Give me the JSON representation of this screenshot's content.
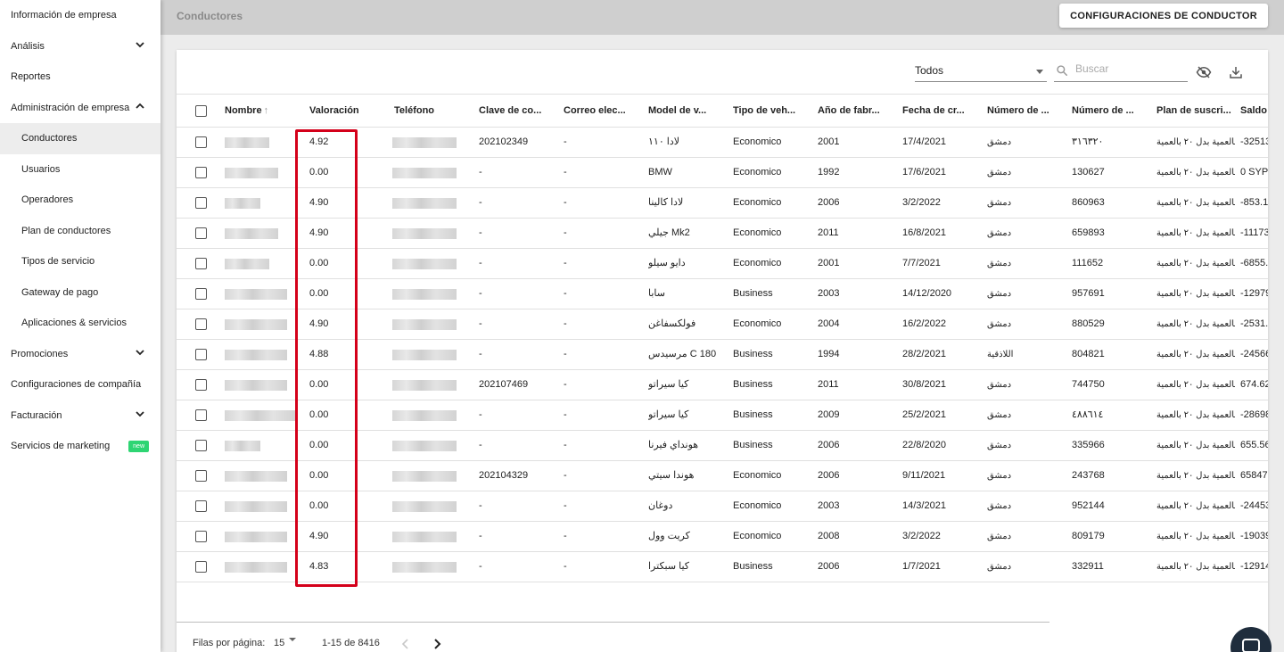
{
  "sidebar": {
    "items": [
      {
        "label": "Información de empresa",
        "level": 0,
        "chevron": "none"
      },
      {
        "label": "Análisis",
        "level": 0,
        "chevron": "down"
      },
      {
        "label": "Reportes",
        "level": 0,
        "chevron": "none"
      },
      {
        "label": "Administración de empresa",
        "level": 0,
        "chevron": "up"
      },
      {
        "label": "Conductores",
        "level": 1,
        "chevron": "none",
        "active": true
      },
      {
        "label": "Usuarios",
        "level": 1,
        "chevron": "none"
      },
      {
        "label": "Operadores",
        "level": 1,
        "chevron": "none"
      },
      {
        "label": "Plan de conductores",
        "level": 1,
        "chevron": "none"
      },
      {
        "label": "Tipos de servicio",
        "level": 1,
        "chevron": "none"
      },
      {
        "label": "Gateway de pago",
        "level": 1,
        "chevron": "none"
      },
      {
        "label": "Aplicaciones & servicios",
        "level": 1,
        "chevron": "none"
      },
      {
        "label": "Promociones",
        "level": 0,
        "chevron": "down"
      },
      {
        "label": "Configuraciones de compañía",
        "level": 0,
        "chevron": "none"
      },
      {
        "label": "Facturación",
        "level": 0,
        "chevron": "down"
      },
      {
        "label": "Servicios de marketing",
        "level": 0,
        "chevron": "none",
        "badge": "new"
      }
    ]
  },
  "header": {
    "title": "Conductores",
    "config_button": "CONFIGURACIONES DE CONDUCTOR"
  },
  "toolbar": {
    "filter_value": "Todos",
    "search_placeholder": "Buscar",
    "icons": [
      "visibility-off-icon",
      "download-icon"
    ]
  },
  "table": {
    "columns": [
      "Nombre",
      "Valoración",
      "Teléfono",
      "Clave de co...",
      "Correo elec...",
      "Model de v...",
      "Tipo de veh...",
      "Año de fabr...",
      "Fecha de cr...",
      "Número de ...",
      "Número de ...",
      "Plan de suscri...",
      "Saldo"
    ],
    "sort_column": "Nombre",
    "sort_direction": "asc",
    "rows": [
      {
        "rating": "4.92",
        "key": "202102349",
        "email": "-",
        "model": "لادا ١١٠",
        "type": "Economico",
        "year": "2001",
        "date": "17/4/2021",
        "city": "دمشق",
        "number": "٣١٦٣٢٠",
        "plan": "بالعمية بدل ٢٠ بالعمية",
        "balance": "-32513"
      },
      {
        "rating": "0.00",
        "key": "-",
        "email": "-",
        "model": "BMW",
        "type": "Economico",
        "year": "1992",
        "date": "17/6/2021",
        "city": "دمشق",
        "number": "130627",
        "plan": "بالعمية بدل ٢٠ بالعمية",
        "balance": "0 SYP"
      },
      {
        "rating": "4.90",
        "key": "-",
        "email": "-",
        "model": "لادا كالينا",
        "type": "Economico",
        "year": "2006",
        "date": "3/2/2022",
        "city": "دمشق",
        "number": "860963",
        "plan": "بالعمية بدل ٢٠ بالعمية",
        "balance": "-853.1"
      },
      {
        "rating": "4.90",
        "key": "-",
        "email": "-",
        "model": "جيلي Mk2",
        "type": "Economico",
        "year": "2011",
        "date": "16/8/2021",
        "city": "دمشق",
        "number": "659893",
        "plan": "بالعمية بدل ٢٠ بالعمية",
        "balance": "-11173"
      },
      {
        "rating": "0.00",
        "key": "-",
        "email": "-",
        "model": "دايو سيلو",
        "type": "Economico",
        "year": "2001",
        "date": "7/7/2021",
        "city": "دمشق",
        "number": "111652",
        "plan": "بالعمية بدل ٢٠ بالعمية",
        "balance": "-6855."
      },
      {
        "rating": "0.00",
        "key": "-",
        "email": "-",
        "model": "سابا",
        "type": "Business",
        "year": "2003",
        "date": "14/12/2020",
        "city": "دمشق",
        "number": "957691",
        "plan": "بالعمية بدل ٢٠ بالعمية",
        "balance": "-12979"
      },
      {
        "rating": "4.90",
        "key": "-",
        "email": "-",
        "model": "فولكسفاغن",
        "type": "Economico",
        "year": "2004",
        "date": "16/2/2022",
        "city": "دمشق",
        "number": "880529",
        "plan": "بالعمية بدل ٢٠ بالعمية",
        "balance": "-2531."
      },
      {
        "rating": "4.88",
        "key": "-",
        "email": "-",
        "model": "مرسيدس C 180",
        "type": "Business",
        "year": "1994",
        "date": "28/2/2021",
        "city": "اللاذقية",
        "number": "804821",
        "plan": "بالعمية بدل ٢٠ بالعمية",
        "balance": "-24566"
      },
      {
        "rating": "0.00",
        "key": "202107469",
        "email": "-",
        "model": "كيا سيراتو",
        "type": "Business",
        "year": "2011",
        "date": "30/8/2021",
        "city": "دمشق",
        "number": "744750",
        "plan": "بالعمية بدل ٢٠ بالعمية",
        "balance": "674.62"
      },
      {
        "rating": "0.00",
        "key": "-",
        "email": "-",
        "model": "كيا سيراتو",
        "type": "Business",
        "year": "2009",
        "date": "25/2/2021",
        "city": "دمشق",
        "number": "٤٨٨٦١٤",
        "plan": "بالعمية بدل ٢٠ بالعمية",
        "balance": "-28698"
      },
      {
        "rating": "0.00",
        "key": "-",
        "email": "-",
        "model": "هونداي فيرنا",
        "type": "Business",
        "year": "2006",
        "date": "22/8/2020",
        "city": "دمشق",
        "number": "335966",
        "plan": "بالعمية بدل ٢٠ بالعمية",
        "balance": "655.56"
      },
      {
        "rating": "0.00",
        "key": "202104329",
        "email": "-",
        "model": "هوندا سيتي",
        "type": "Economico",
        "year": "2006",
        "date": "9/11/2021",
        "city": "دمشق",
        "number": "243768",
        "plan": "بالعمية بدل ٢٠ بالعمية",
        "balance": "65847"
      },
      {
        "rating": "0.00",
        "key": "-",
        "email": "-",
        "model": "دوغان",
        "type": "Economico",
        "year": "2003",
        "date": "14/3/2021",
        "city": "دمشق",
        "number": "952144",
        "plan": "بالعمية بدل ٢٠ بالعمية",
        "balance": "-24453"
      },
      {
        "rating": "4.90",
        "key": "-",
        "email": "-",
        "model": "كريت وول",
        "type": "Economico",
        "year": "2008",
        "date": "3/2/2022",
        "city": "دمشق",
        "number": "809179",
        "plan": "بالعمية بدل ٢٠ بالعمية",
        "balance": "-19039"
      },
      {
        "rating": "4.83",
        "key": "-",
        "email": "-",
        "model": "كيا سبكترا",
        "type": "Business",
        "year": "2006",
        "date": "1/7/2021",
        "city": "دمشق",
        "number": "332911",
        "plan": "بالعمية بدل ٢٠ بالعمية",
        "balance": "-12914"
      }
    ]
  },
  "pagination": {
    "rows_per_page_label": "Filas por página:",
    "rows_per_page": "15",
    "range": "1-15 de 8416"
  },
  "colors": {
    "highlight": "#d4001a",
    "badge": "#2ed573",
    "topbar": "#cfcfcf"
  }
}
